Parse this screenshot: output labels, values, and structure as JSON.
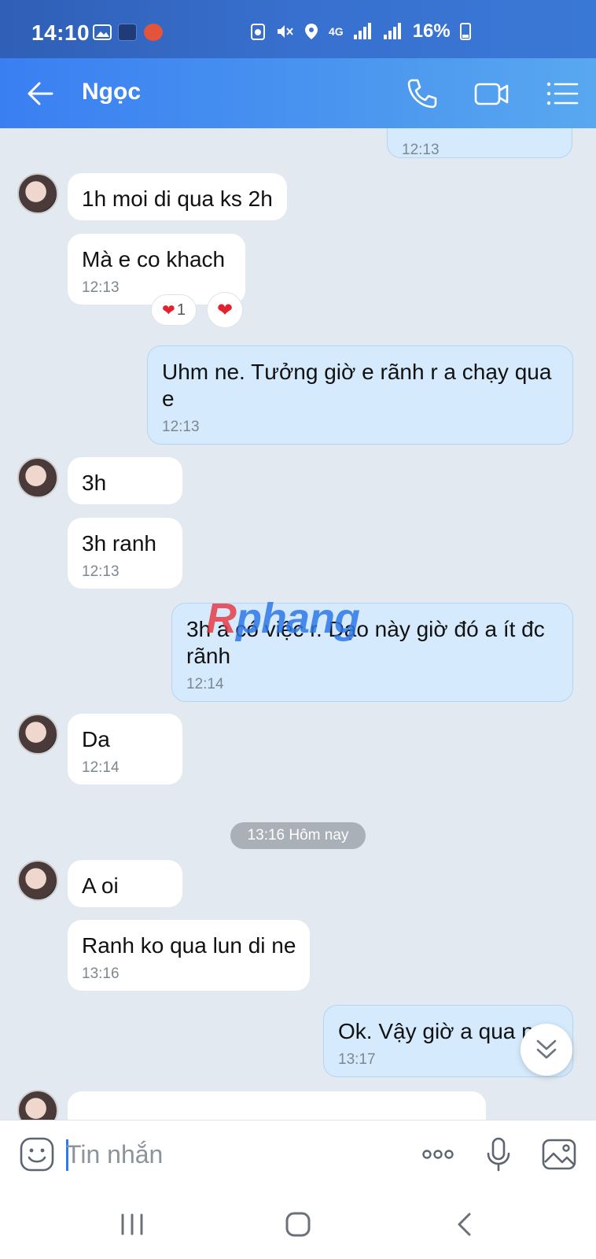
{
  "status_bar": {
    "time": "14:10",
    "network": "4G",
    "battery": "16%"
  },
  "header": {
    "contact_name": "Ngọc"
  },
  "messages": [
    {
      "id": "m0",
      "dir": "out",
      "text": "",
      "time": "12:13"
    },
    {
      "id": "m1",
      "dir": "in",
      "text": "1h moi di qua ks 2h",
      "time": ""
    },
    {
      "id": "m2",
      "dir": "in",
      "text": "Mà e co khach",
      "time": "12:13",
      "reaction_count": "1"
    },
    {
      "id": "m3",
      "dir": "out",
      "text": "Uhm ne. Tưởng giờ e rãnh r a chạy qua e",
      "time": "12:13"
    },
    {
      "id": "m4",
      "dir": "in",
      "text": "3h",
      "time": ""
    },
    {
      "id": "m5",
      "dir": "in",
      "text": "3h ranh",
      "time": "12:13"
    },
    {
      "id": "m6",
      "dir": "out",
      "text": "3h a có việc r. Dạo này giờ đó a ít đc rãnh",
      "time": "12:14"
    },
    {
      "id": "m7",
      "dir": "in",
      "text": "Da",
      "time": "12:14"
    },
    {
      "id": "m8",
      "dir": "in",
      "text": "A oi",
      "time": ""
    },
    {
      "id": "m9",
      "dir": "in",
      "text": "Ranh ko qua lun di ne",
      "time": "13:16"
    },
    {
      "id": "m10",
      "dir": "out",
      "text": "Ok. Vậy giờ a qua n",
      "time": "13:17"
    }
  ],
  "day_separator": "13:16 Hôm nay",
  "watermark": {
    "part1": "R",
    "part2": "phang"
  },
  "composer": {
    "placeholder": "Tin nhắn",
    "value": ""
  },
  "colors": {
    "header": "#3a7ff2",
    "outgoing_bubble": "#d5ebfd",
    "incoming_bubble": "#ffffff",
    "background": "#e2e9f1"
  }
}
